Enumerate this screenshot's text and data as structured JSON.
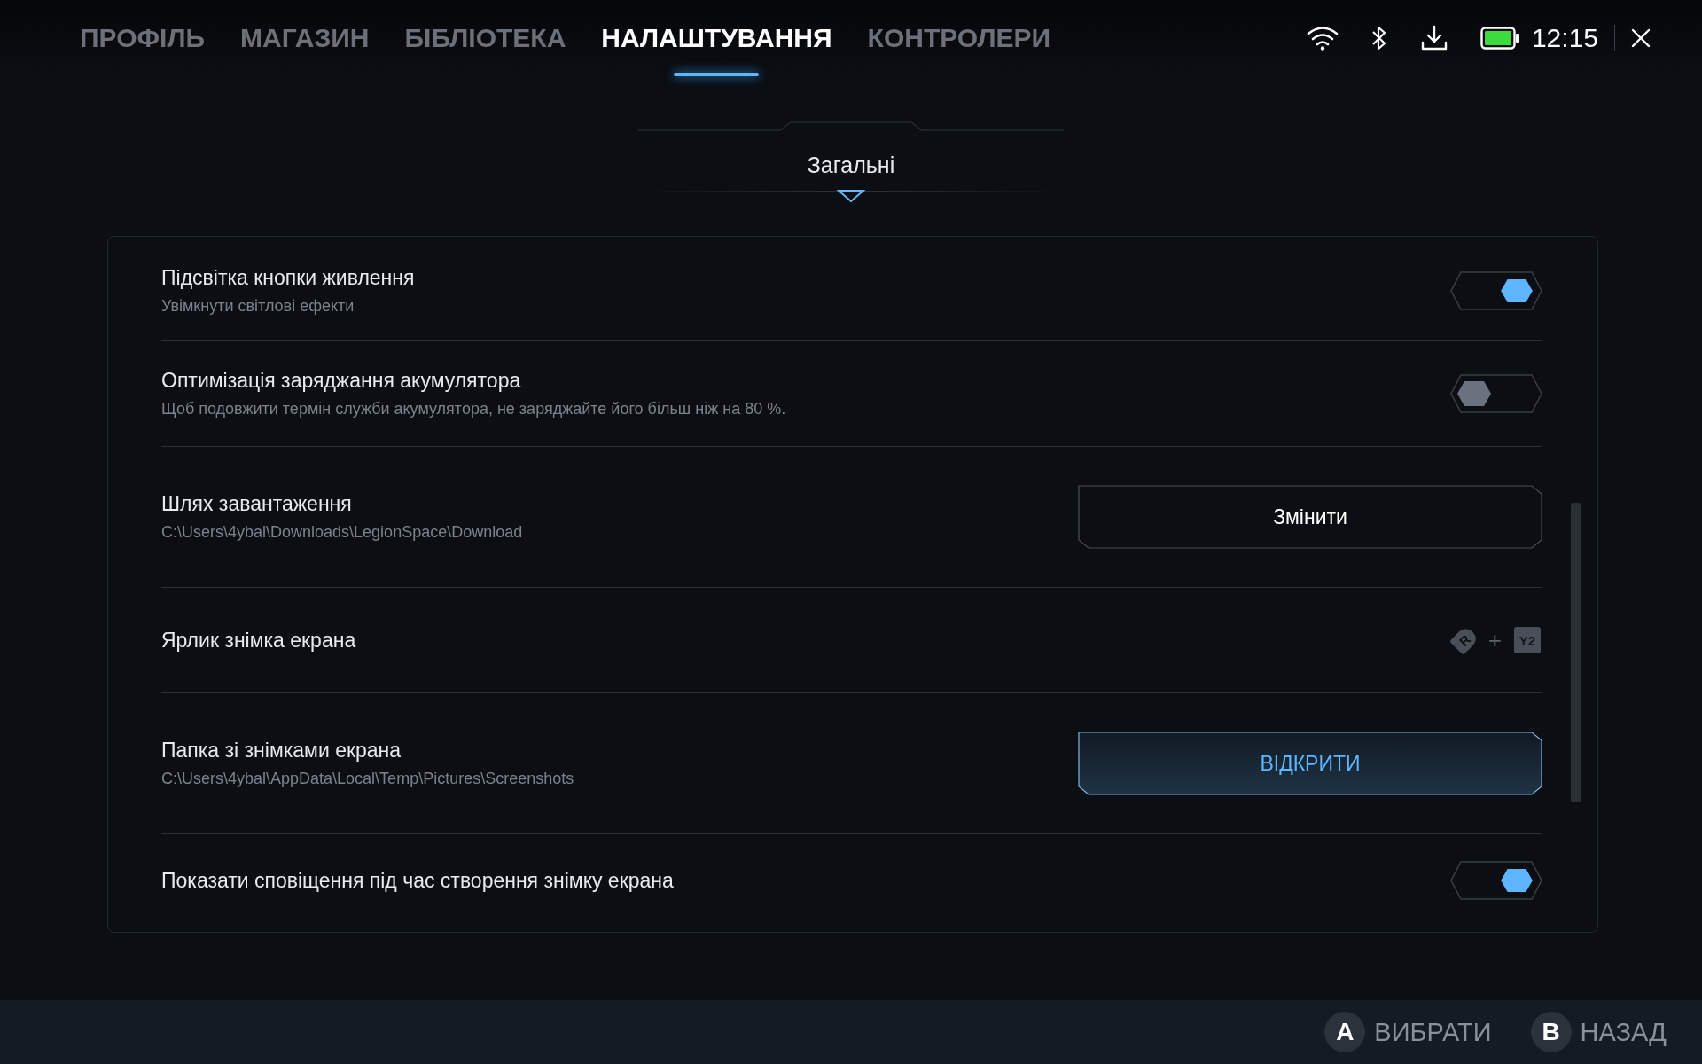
{
  "nav": {
    "tabs": [
      {
        "label": "ПРОФІЛЬ",
        "selected": false
      },
      {
        "label": "МАГАЗИН",
        "selected": false
      },
      {
        "label": "БІБЛІОТЕКА",
        "selected": false
      },
      {
        "label": "НАЛАШТУВАННЯ",
        "selected": true
      },
      {
        "label": "КОНТРОЛЕРИ",
        "selected": false
      }
    ],
    "status": {
      "time": "12:15"
    }
  },
  "section": {
    "title": "Загальні"
  },
  "settings": [
    {
      "kind": "toggle",
      "title": "Підсвітка кнопки живлення",
      "subtitle": "Увімкнути світлові ефекти",
      "on": true
    },
    {
      "kind": "toggle",
      "title": "Оптимізація заряджання акумулятора",
      "subtitle": "Щоб подовжити термін служби акумулятора, не заряджайте його більш ніж на 80 %.",
      "on": false
    },
    {
      "kind": "button",
      "title": "Шлях завантаження",
      "subtitle": "C:\\Users\\4ybal\\Downloads\\LegionSpace\\Download",
      "button": "Змінити",
      "primary": false
    },
    {
      "kind": "shortcut",
      "title": "Ярлик знімка екрана",
      "keys": [
        "R",
        "Y2"
      ],
      "joiner": "+"
    },
    {
      "kind": "button",
      "title": "Папка зі знімками екрана",
      "subtitle": "C:\\Users\\4ybal\\AppData\\Local\\Temp\\Pictures\\Screenshots",
      "button": "ВІДКРИТИ",
      "primary": true
    },
    {
      "kind": "toggle",
      "title": "Показати сповіщення під час створення знімку екрана",
      "on": true
    }
  ],
  "footer": {
    "hints": [
      {
        "key": "A",
        "label": "ВИБРАТИ"
      },
      {
        "key": "B",
        "label": "НАЗАД"
      }
    ]
  }
}
